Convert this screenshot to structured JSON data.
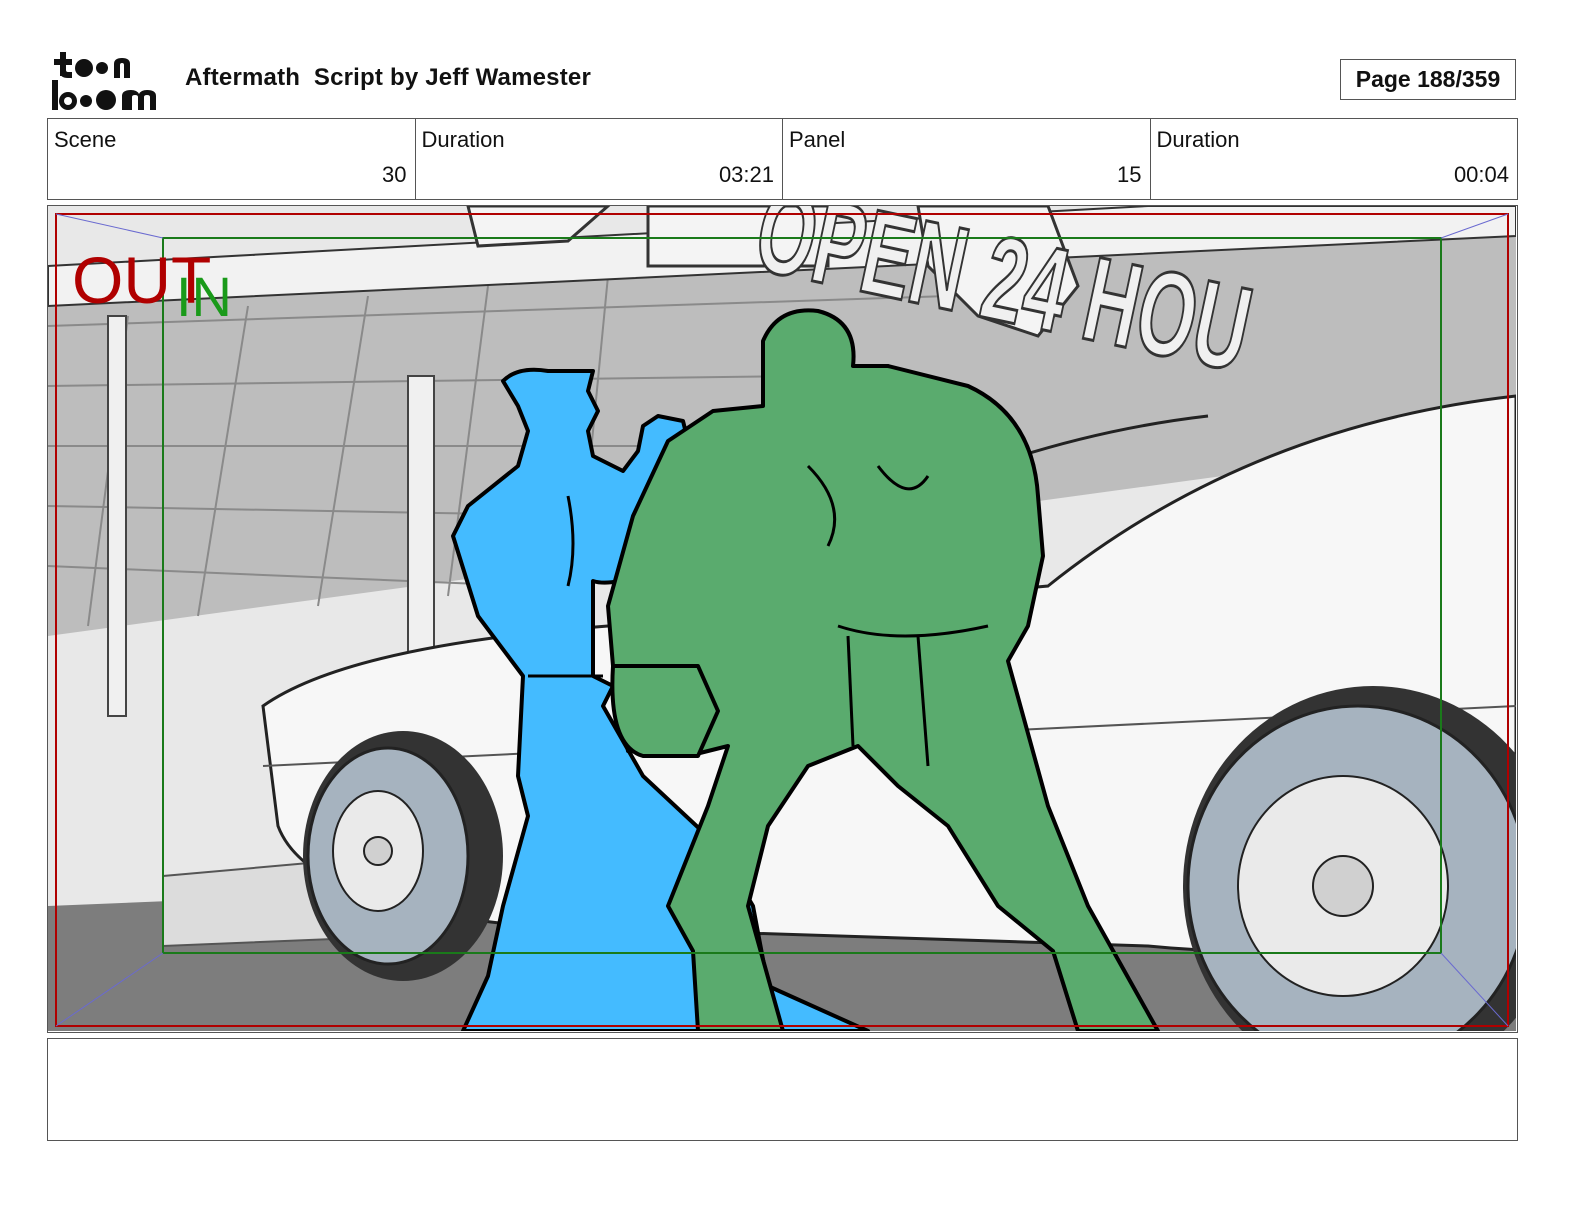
{
  "header": {
    "logo_name": "toon boom",
    "title": "Aftermath  Script by Jeff Wamester",
    "page": "Page 188/359"
  },
  "info": {
    "scene_label": "Scene",
    "scene_value": "30",
    "scene_duration_label": "Duration",
    "scene_duration_value": "03:21",
    "panel_label": "Panel",
    "panel_value": "15",
    "panel_duration_label": "Duration",
    "panel_duration_value": "00:04"
  },
  "panel": {
    "out_label": "OUT",
    "in_label": "IN",
    "sign_text": "OPEN 24 HOU",
    "colors": {
      "out_frame": "#b00000",
      "in_frame": "#1a7a1a",
      "hero_fill": "#44bbff",
      "brute_fill": "#5aab6e",
      "ground": "#7d7d7d",
      "tire": "#a6b3bf"
    }
  },
  "notes": {
    "text": ""
  }
}
